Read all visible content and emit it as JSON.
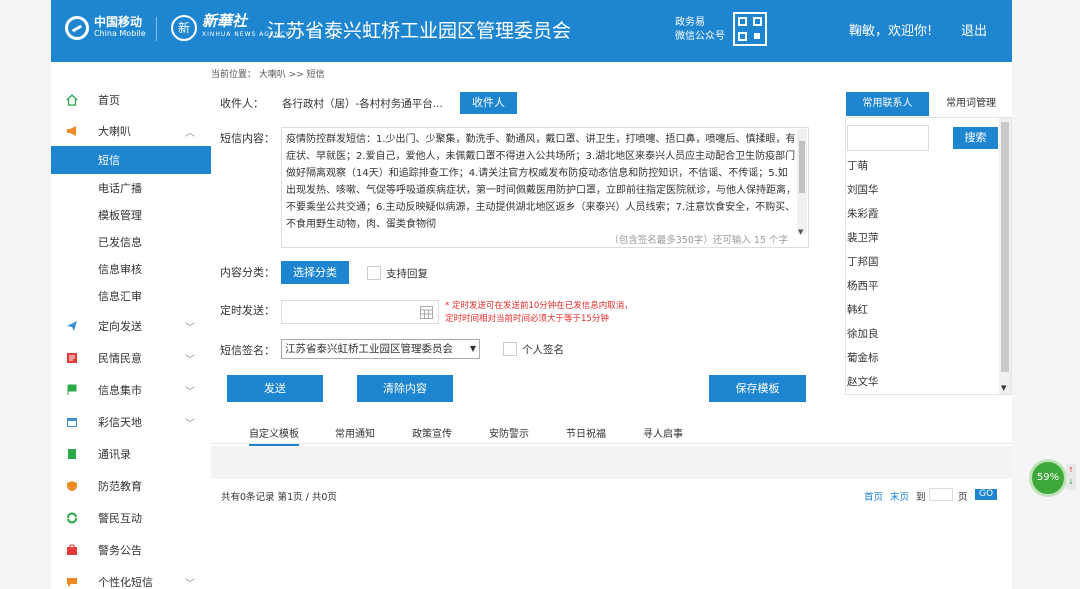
{
  "header": {
    "cm_cn": "中国移动",
    "cm_en": "China Mobile",
    "xh_seal": "新",
    "xh_cn": "新華社",
    "xh_en": "XINHUA NEWS AGENCY",
    "title": "江苏省泰兴虹桥工业园区管理委员会",
    "wx_line1": "政务易",
    "wx_line2": "微信公众号",
    "welcome": "鞠敏，欢迎你!",
    "logout": "退出"
  },
  "breadcrumb": "当前位置： 大喇叭 >> 短信",
  "sidebar": {
    "home": "首页",
    "dalaba": "大喇叭",
    "duanxin": "短信",
    "dianhua": "电话广播",
    "muban": "模板管理",
    "yifa": "已发信息",
    "shenhe": "信息审核",
    "huizong": "信息汇审",
    "dingxiang": "定向发送",
    "minqing": "民情民意",
    "jishi": "信息集市",
    "caixin": "彩信天地",
    "tongxunlu": "通讯录",
    "fangfan": "防范教育",
    "jingmin": "警民互动",
    "jingwu": "警务公告",
    "gexinghua": "个性化短信"
  },
  "form": {
    "recipient_label": "收件人：",
    "recipient_value": "各行政村（居）-各村村务通平台...",
    "recipient_button": "收件人",
    "content_label": "短信内容：",
    "content_text": "疫情防控群发短信：1.少出门、少聚集，勤洗手、勤通风，戴口罩、讲卫生，打喷嚏、捂口鼻，喷嚏后、慎揉眼，有症状、早就医；2.爱自己，爱他人，未佩戴口罩不得进入公共场所；3.湖北地区来泰兴人员应主动配合卫生防疫部门做好隔离观察（14天）和追踪排查工作；4.请关注官方权威发布防疫动态信息和防控知识，不信谣、不传谣；5.如出现发热、咳嗽、气促等呼吸道疾病症状，第一时间佩戴医用防护口罩，立即前往指定医院就诊，与他人保持距离，不要乘坐公共交通；6.主动反映疑似病源，主动提供湖北地区返乡（来泰兴）人员线索；7.注意饮食安全，不购买、不食用野生动物，肉、蛋类食物彻",
    "char_count": "（包含签名最多350字）还可输入 15 个字",
    "category_label": "内容分类：",
    "category_button": "选择分类",
    "reply_label": "支持回复",
    "timed_label": "定时发送：",
    "timed_note_1": "* 定时发送可在发送前10分钟在已发信息内取消，",
    "timed_note_2": "定时时间相对当前时间必须大于等于15分钟",
    "sign_label": "短信签名：",
    "sign_value": "江苏省泰兴虹桥工业园区管理委员会",
    "personal_sign": "个人签名",
    "send": "发送",
    "clear": "清除内容",
    "save_template": "保存模板"
  },
  "tabs": [
    "自定义模板",
    "常用通知",
    "政策宣传",
    "安防警示",
    "节日祝福",
    "寻人启事"
  ],
  "pager": {
    "summary": "共有0条记录 第1页 / 共0页",
    "first": "首页",
    "last": "末页",
    "goto": "到",
    "page": "页",
    "go": "GO"
  },
  "contacts": {
    "tab_contacts": "常用联系人",
    "tab_phrases": "常用词管理",
    "search": "搜索",
    "names": [
      "丁萌",
      "刘国华",
      "朱彩霞",
      "裴卫萍",
      "丁邦国",
      "杨西平",
      "韩红",
      "徐加良",
      "葡金标",
      "赵文华"
    ]
  },
  "gauge": "59%",
  "colors": {
    "accent": "#1e86d1",
    "warning": "#e52b2b"
  }
}
